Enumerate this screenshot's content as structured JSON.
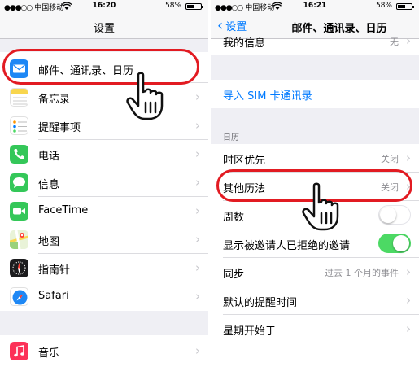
{
  "left": {
    "status": {
      "carrier": "中国移动",
      "time": "16:20",
      "battery": "58%",
      "battery_level": 0.58
    },
    "nav_title": "设置",
    "items": [
      {
        "label": "邮件、通讯录、日历",
        "icon": "mail-icon",
        "color": "#1e88f5"
      },
      {
        "label": "备忘录",
        "icon": "notes-icon",
        "color": "#f8d64e"
      },
      {
        "label": "提醒事项",
        "icon": "reminders-icon",
        "color": "#ffffff"
      },
      {
        "label": "电话",
        "icon": "phone-icon",
        "color": "#34c759"
      },
      {
        "label": "信息",
        "icon": "messages-icon",
        "color": "#34c759"
      },
      {
        "label": "FaceTime",
        "icon": "facetime-icon",
        "color": "#34c759"
      },
      {
        "label": "地图",
        "icon": "maps-icon",
        "color": "#9ad17b"
      },
      {
        "label": "指南针",
        "icon": "compass-icon",
        "color": "#1c1c1e"
      },
      {
        "label": "Safari",
        "icon": "safari-icon",
        "color": "#1e88f5"
      },
      {
        "label": "音乐",
        "icon": "music-icon",
        "color": "#fc3158"
      }
    ]
  },
  "right": {
    "status": {
      "carrier": "中国移动",
      "time": "16:21",
      "battery": "58%",
      "battery_level": 0.58
    },
    "nav_back": "设置",
    "nav_title": "邮件、通讯录、日历",
    "partial_row": {
      "label": "我的信息",
      "value": "无"
    },
    "import_sim": "导入 SIM 卡通讯录",
    "section_calendar": "日历",
    "rows": [
      {
        "label": "时区优先",
        "value": "关闭",
        "control": "chevron"
      },
      {
        "label": "其他历法",
        "value": "关闭",
        "control": "chevron"
      },
      {
        "label": "周数",
        "value": "",
        "control": "toggle-off"
      },
      {
        "label": "显示被邀请人已拒绝的邀请",
        "value": "",
        "control": "toggle-on"
      },
      {
        "label": "同步",
        "value": "过去 1 个月的事件",
        "control": "chevron"
      },
      {
        "label": "默认的提醒时间",
        "value": "",
        "control": "chevron"
      },
      {
        "label": "星期开始于",
        "value": "",
        "control": "chevron"
      }
    ]
  },
  "colors": {
    "accent": "#007aff",
    "highlight": "#e21b22",
    "toggle_on": "#4cd964"
  }
}
